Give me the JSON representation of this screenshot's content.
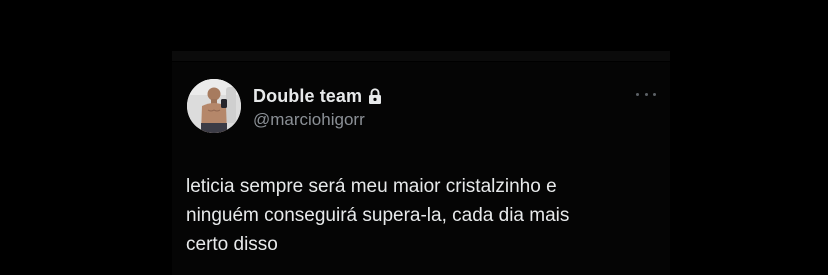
{
  "tweet": {
    "author": {
      "display_name": "Double team",
      "handle": "@marciohigorr",
      "protected_icon": "lock-icon",
      "avatar": "avatar"
    },
    "more_icon": "more-horizontal-icon",
    "text": "leticia sempre será meu maior cristalzinho e\nninguém conseguirá supera-la, cada dia mais\ncerto disso"
  },
  "colors": {
    "background": "#000000",
    "card": "#050505",
    "primary_text": "#e7e9ea",
    "secondary_text": "#8b9096"
  }
}
